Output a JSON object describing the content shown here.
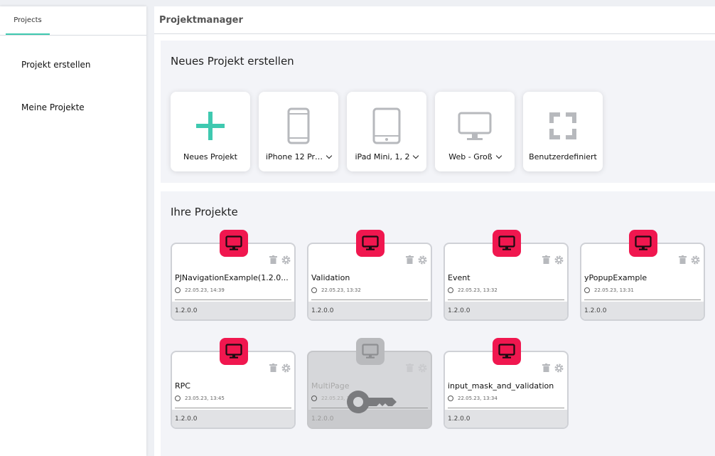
{
  "sidebar": {
    "tab_label": "Projects",
    "items": [
      {
        "label": "Projekt erstellen"
      },
      {
        "label": "Meine Projekte"
      }
    ]
  },
  "main": {
    "title": "Projektmanager"
  },
  "new_project": {
    "title": "Neues Projekt erstellen",
    "templates": [
      {
        "label": "Neues Projekt",
        "icon": "plus-icon"
      },
      {
        "label": "iPhone 12 Pr…",
        "icon": "phone-icon"
      },
      {
        "label": "iPad Mini, 1, 2",
        "icon": "tablet-icon"
      },
      {
        "label": "Web - Groß",
        "icon": "monitor-icon"
      },
      {
        "label": "Benutzerdefiniert",
        "icon": "custom-size-icon"
      }
    ]
  },
  "projects": {
    "title": "Ihre Projekte",
    "items": [
      {
        "name": "PJNavigationExample(1.2.0...",
        "date": "22.05.23, 14:39",
        "version": "1.2.0.0",
        "locked": false
      },
      {
        "name": "Validation",
        "date": "22.05.23, 13:32",
        "version": "1.2.0.0",
        "locked": false
      },
      {
        "name": "Event",
        "date": "22.05.23, 13:32",
        "version": "1.2.0.0",
        "locked": false
      },
      {
        "name": "yPopupExample",
        "date": "22.05.23, 13:31",
        "version": "1.2.0.0",
        "locked": false
      },
      {
        "name": "RPC",
        "date": "23.05.23, 13:45",
        "version": "1.2.0.0",
        "locked": false
      },
      {
        "name": "MultiPage",
        "date": "22.05.23, 13:4",
        "version": "1.2.0.0",
        "locked": true
      },
      {
        "name": "input_mask_and_validation",
        "date": "22.05.23, 13:34",
        "version": "1.2.0.0",
        "locked": false
      }
    ]
  },
  "colors": {
    "accent": "#3fc9b0",
    "badge_active": "#f0174f",
    "badge_locked": "#b9babd",
    "icon_gray": "#b7b9bd"
  }
}
